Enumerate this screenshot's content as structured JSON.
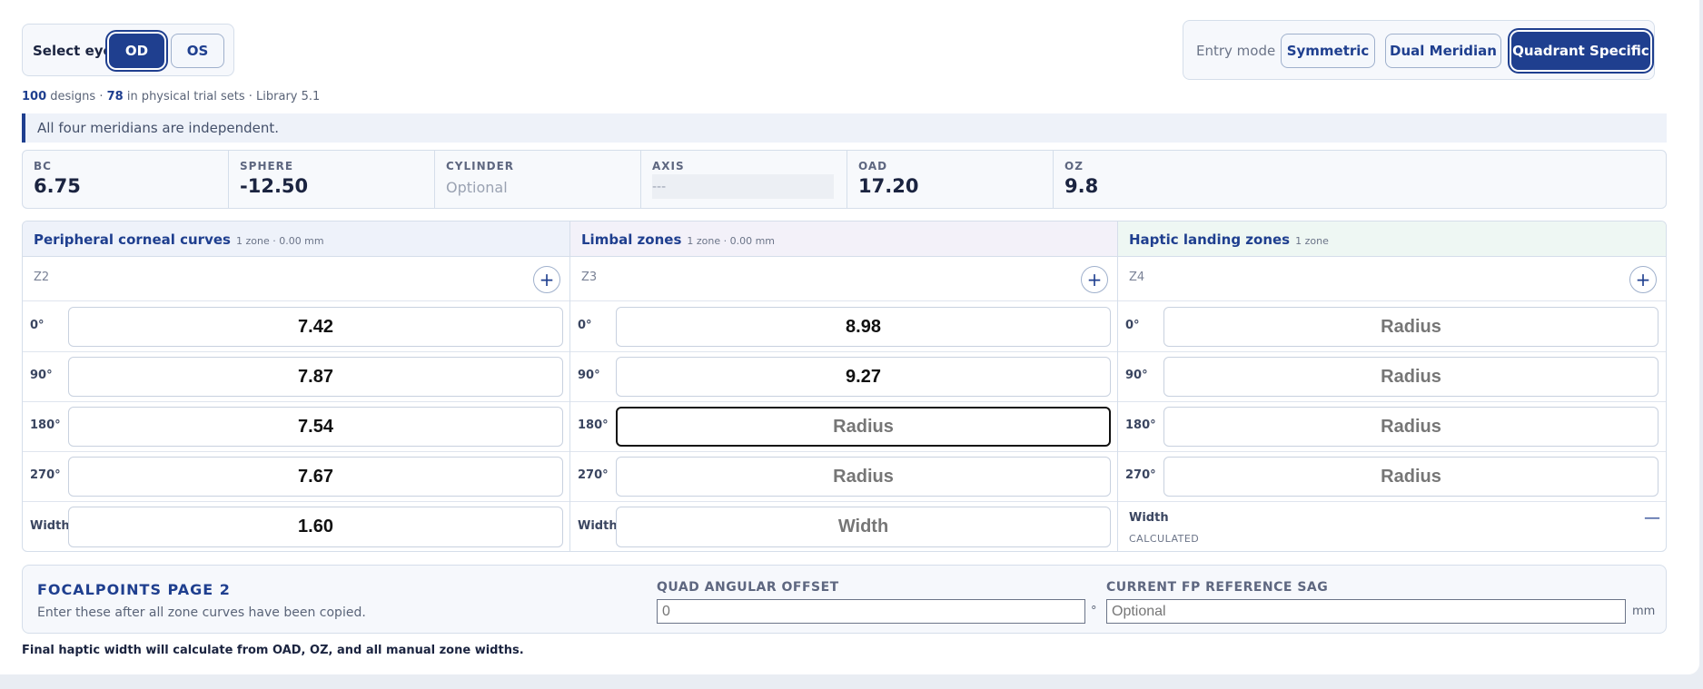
{
  "eye_select": {
    "label": "Select eye",
    "options": [
      "OD",
      "OS"
    ],
    "selected": "OD"
  },
  "entry_mode": {
    "label": "Entry mode",
    "options": [
      "Symmetric",
      "Dual Meridian",
      "Quadrant Specific"
    ],
    "selected": "Quadrant Specific"
  },
  "library": {
    "designs_count": "100",
    "designs_text": "designs ·",
    "trial_count": "78",
    "trial_text": "in physical trial sets · Library 5.1"
  },
  "info_banner": "All four meridians are independent.",
  "stats": {
    "bc": {
      "label": "BC",
      "value": "6.75"
    },
    "sphere": {
      "label": "SPHERE",
      "value": "-12.50"
    },
    "cylinder": {
      "label": "CYLINDER",
      "placeholder": "Optional"
    },
    "axis": {
      "label": "AXIS",
      "placeholder": "---"
    },
    "oad": {
      "label": "OAD",
      "value": "17.20"
    },
    "oz": {
      "label": "OZ",
      "value": "9.8"
    }
  },
  "columns": [
    {
      "title": "Peripheral corneal curves",
      "meta": "1 zone · 0.00 mm",
      "zone": "Z2",
      "rows": [
        {
          "label": "0°",
          "value": "7.42"
        },
        {
          "label": "90°",
          "value": "7.87"
        },
        {
          "label": "180°",
          "value": "7.54"
        },
        {
          "label": "270°",
          "value": "7.67"
        }
      ],
      "width": {
        "label": "Width",
        "value": "1.60"
      }
    },
    {
      "title": "Limbal zones",
      "meta": "1 zone · 0.00 mm",
      "zone": "Z3",
      "rows": [
        {
          "label": "0°",
          "value": "8.98"
        },
        {
          "label": "90°",
          "value": "9.27"
        },
        {
          "label": "180°",
          "placeholder": "Radius"
        },
        {
          "label": "270°",
          "placeholder": "Radius"
        }
      ],
      "width": {
        "label": "Width",
        "placeholder": "Width"
      }
    },
    {
      "title": "Haptic landing zones",
      "meta": "1 zone",
      "zone": "Z4",
      "rows": [
        {
          "label": "0°",
          "placeholder": "Radius"
        },
        {
          "label": "90°",
          "placeholder": "Radius"
        },
        {
          "label": "180°",
          "placeholder": "Radius"
        },
        {
          "label": "270°",
          "placeholder": "Radius"
        }
      ],
      "width": {
        "label": "Width",
        "sub": "CALCULATED",
        "value": "—"
      }
    }
  ],
  "plus_symbol": "+",
  "focalpoints": {
    "title": "FOCALPOINTS PAGE 2",
    "subtitle": "Enter these after all zone curves have been copied.",
    "quad_offset": {
      "label": "QUAD ANGULAR OFFSET",
      "placeholder": "0",
      "unit": "°"
    },
    "ref_sag": {
      "label": "CURRENT FP REFERENCE SAG",
      "placeholder": "Optional",
      "unit": "mm"
    }
  },
  "footnote": "Final haptic width will calculate from OAD, OZ, and all manual zone widths.",
  "colors": {
    "accent": "#1f3f8f",
    "border": "#d5deea",
    "panel": "#f6f8fc"
  }
}
